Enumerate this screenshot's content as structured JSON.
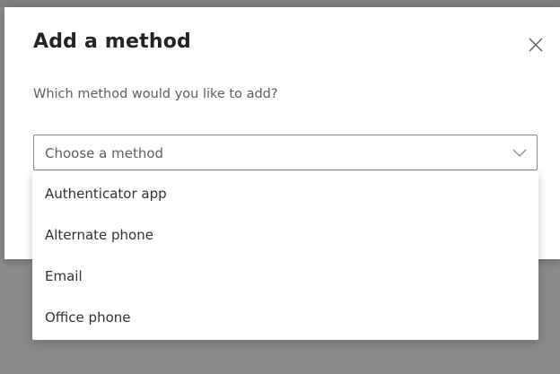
{
  "dialog": {
    "title": "Add a method",
    "prompt": "Which method would you like to add?",
    "select": {
      "value": "Choose a method",
      "options": [
        "Authenticator app",
        "Alternate phone",
        "Email",
        "Office phone"
      ]
    }
  },
  "icons": {
    "close": "close-icon",
    "chevron": "chevron-down-icon"
  },
  "colors": {
    "overlay": "#8a8a8a",
    "dialog_bg": "#ffffff",
    "text_primary": "#242424",
    "text_secondary": "#605e5c",
    "border": "#8a8886"
  }
}
